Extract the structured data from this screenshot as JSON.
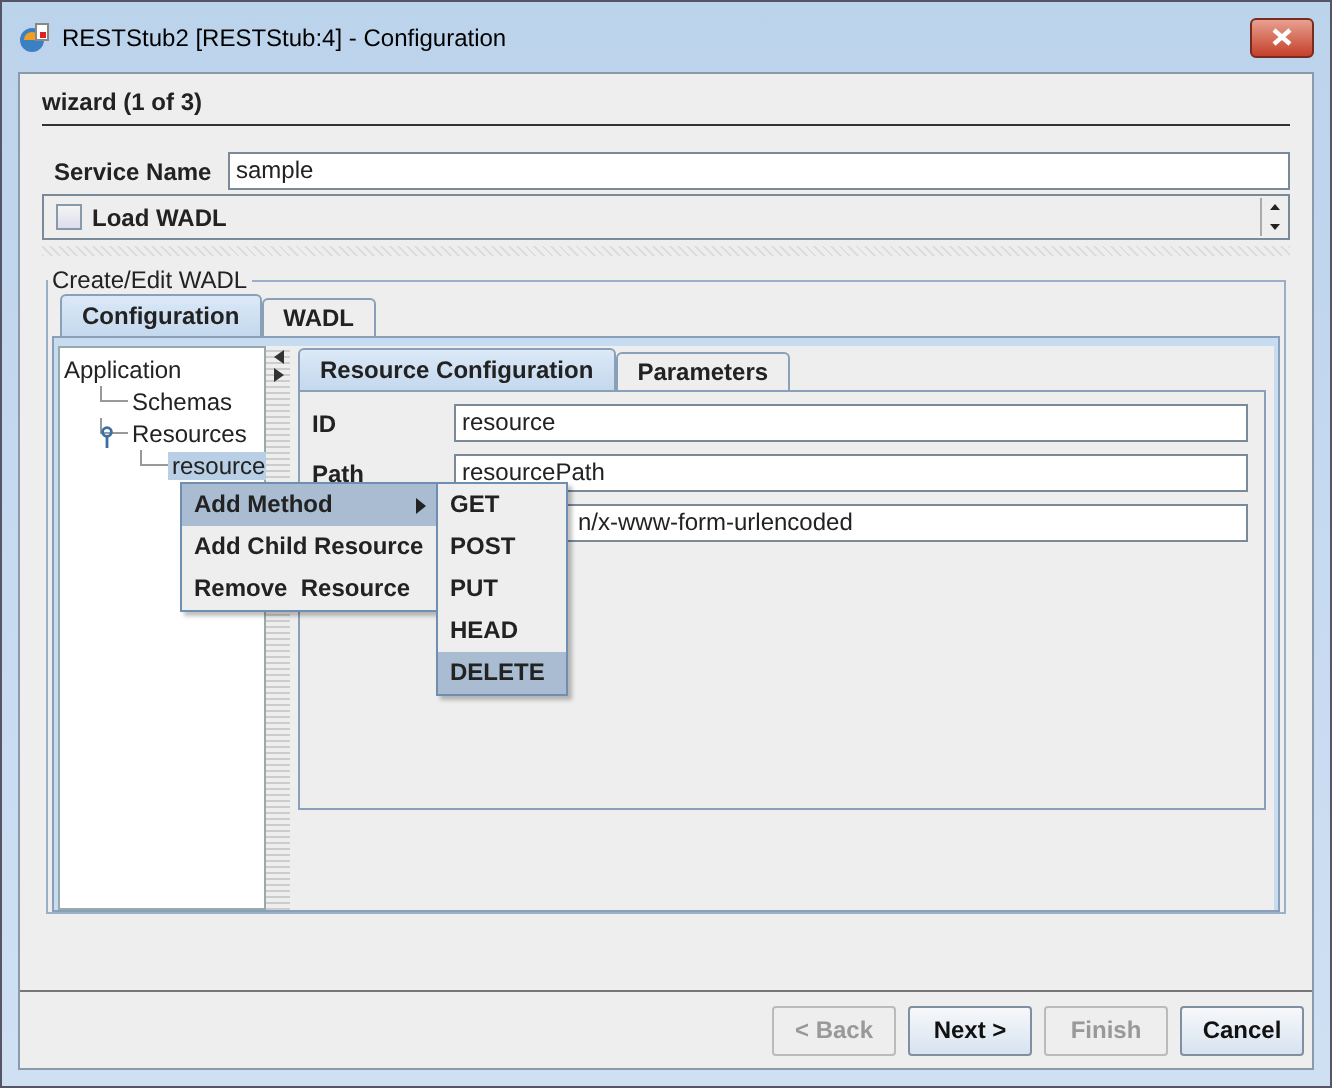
{
  "window": {
    "title": "RESTStub2 [RESTStub:4] - Configuration"
  },
  "wizard_step": "wizard (1 of 3)",
  "service_name": {
    "label": "Service Name",
    "value": "sample"
  },
  "load_wadl": {
    "label": "Load WADL",
    "checked": false
  },
  "group": {
    "title": "Create/Edit WADL",
    "tabs": [
      {
        "label": "Configuration",
        "selected": true
      },
      {
        "label": "WADL",
        "selected": false
      }
    ],
    "tree": [
      {
        "label": "Application",
        "selected": false,
        "children": [
          {
            "label": "Schemas",
            "selected": false
          },
          {
            "label": "Resources",
            "selected": false,
            "children": [
              {
                "label": "resource",
                "selected": true
              }
            ]
          }
        ]
      }
    ],
    "detail_tabs": [
      {
        "label": "Resource Configuration",
        "selected": true
      },
      {
        "label": "Parameters",
        "selected": false
      }
    ],
    "fields": [
      {
        "label": "ID",
        "value": "resource"
      },
      {
        "label": "Path",
        "value": "resourcePath"
      },
      {
        "value": "n/x-www-form-urlencoded"
      }
    ]
  },
  "context_menu": [
    {
      "label": "Add Method",
      "selected": true,
      "submenu": true
    },
    {
      "label": "Add Child Resource",
      "selected": false,
      "submenu": false
    },
    {
      "label": "Remove  Resource",
      "selected": false,
      "submenu": false
    }
  ],
  "submenu": [
    {
      "label": "GET",
      "selected": false
    },
    {
      "label": "POST",
      "selected": false
    },
    {
      "label": "PUT",
      "selected": false
    },
    {
      "label": "HEAD",
      "selected": false
    },
    {
      "label": "DELETE",
      "selected": true
    }
  ],
  "buttons": [
    {
      "label": "< Back",
      "disabled": true
    },
    {
      "label": "Next >",
      "disabled": false
    },
    {
      "label": "Finish",
      "disabled": true
    },
    {
      "label": "Cancel",
      "disabled": false
    }
  ]
}
